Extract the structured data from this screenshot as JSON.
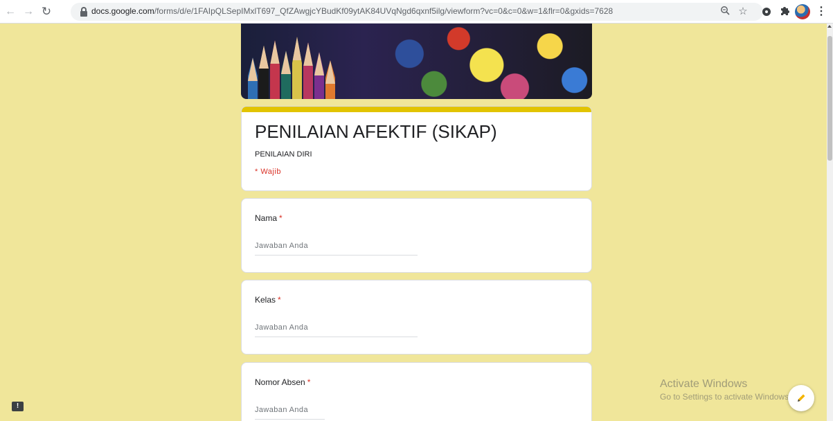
{
  "browser": {
    "back_icon": "arrow-left-icon",
    "forward_icon": "arrow-right-icon",
    "reload_icon": "reload-icon",
    "url_host": "docs.google.com",
    "url_path": "/forms/d/e/1FAIpQLSepIMxlT697_QfZAwgjcYBudKf09ytAK84UVqNgd6qxnf5ilg/viewform?vc=0&c=0&w=1&flr=0&gxids=7628",
    "menu_glyph": "⋮"
  },
  "form": {
    "title": "PENILAIAN AFEKTIF (SIKAP)",
    "description": "PENILAIAN DIRI",
    "required_note": "* Wajib",
    "accent_color": "#e2c400",
    "background_color": "#f0e69a",
    "questions": [
      {
        "label": "Nama",
        "required_mark": "*",
        "placeholder": "Jawaban Anda"
      },
      {
        "label": "Kelas",
        "required_mark": "*",
        "placeholder": "Jawaban Anda"
      },
      {
        "label": "Nomor Absen",
        "required_mark": "*",
        "placeholder": "Jawaban Anda"
      }
    ]
  },
  "overlay": {
    "activate_title": "Activate Windows",
    "activate_sub": "Go to Settings to activate Windows.",
    "feedback_glyph": "!"
  }
}
